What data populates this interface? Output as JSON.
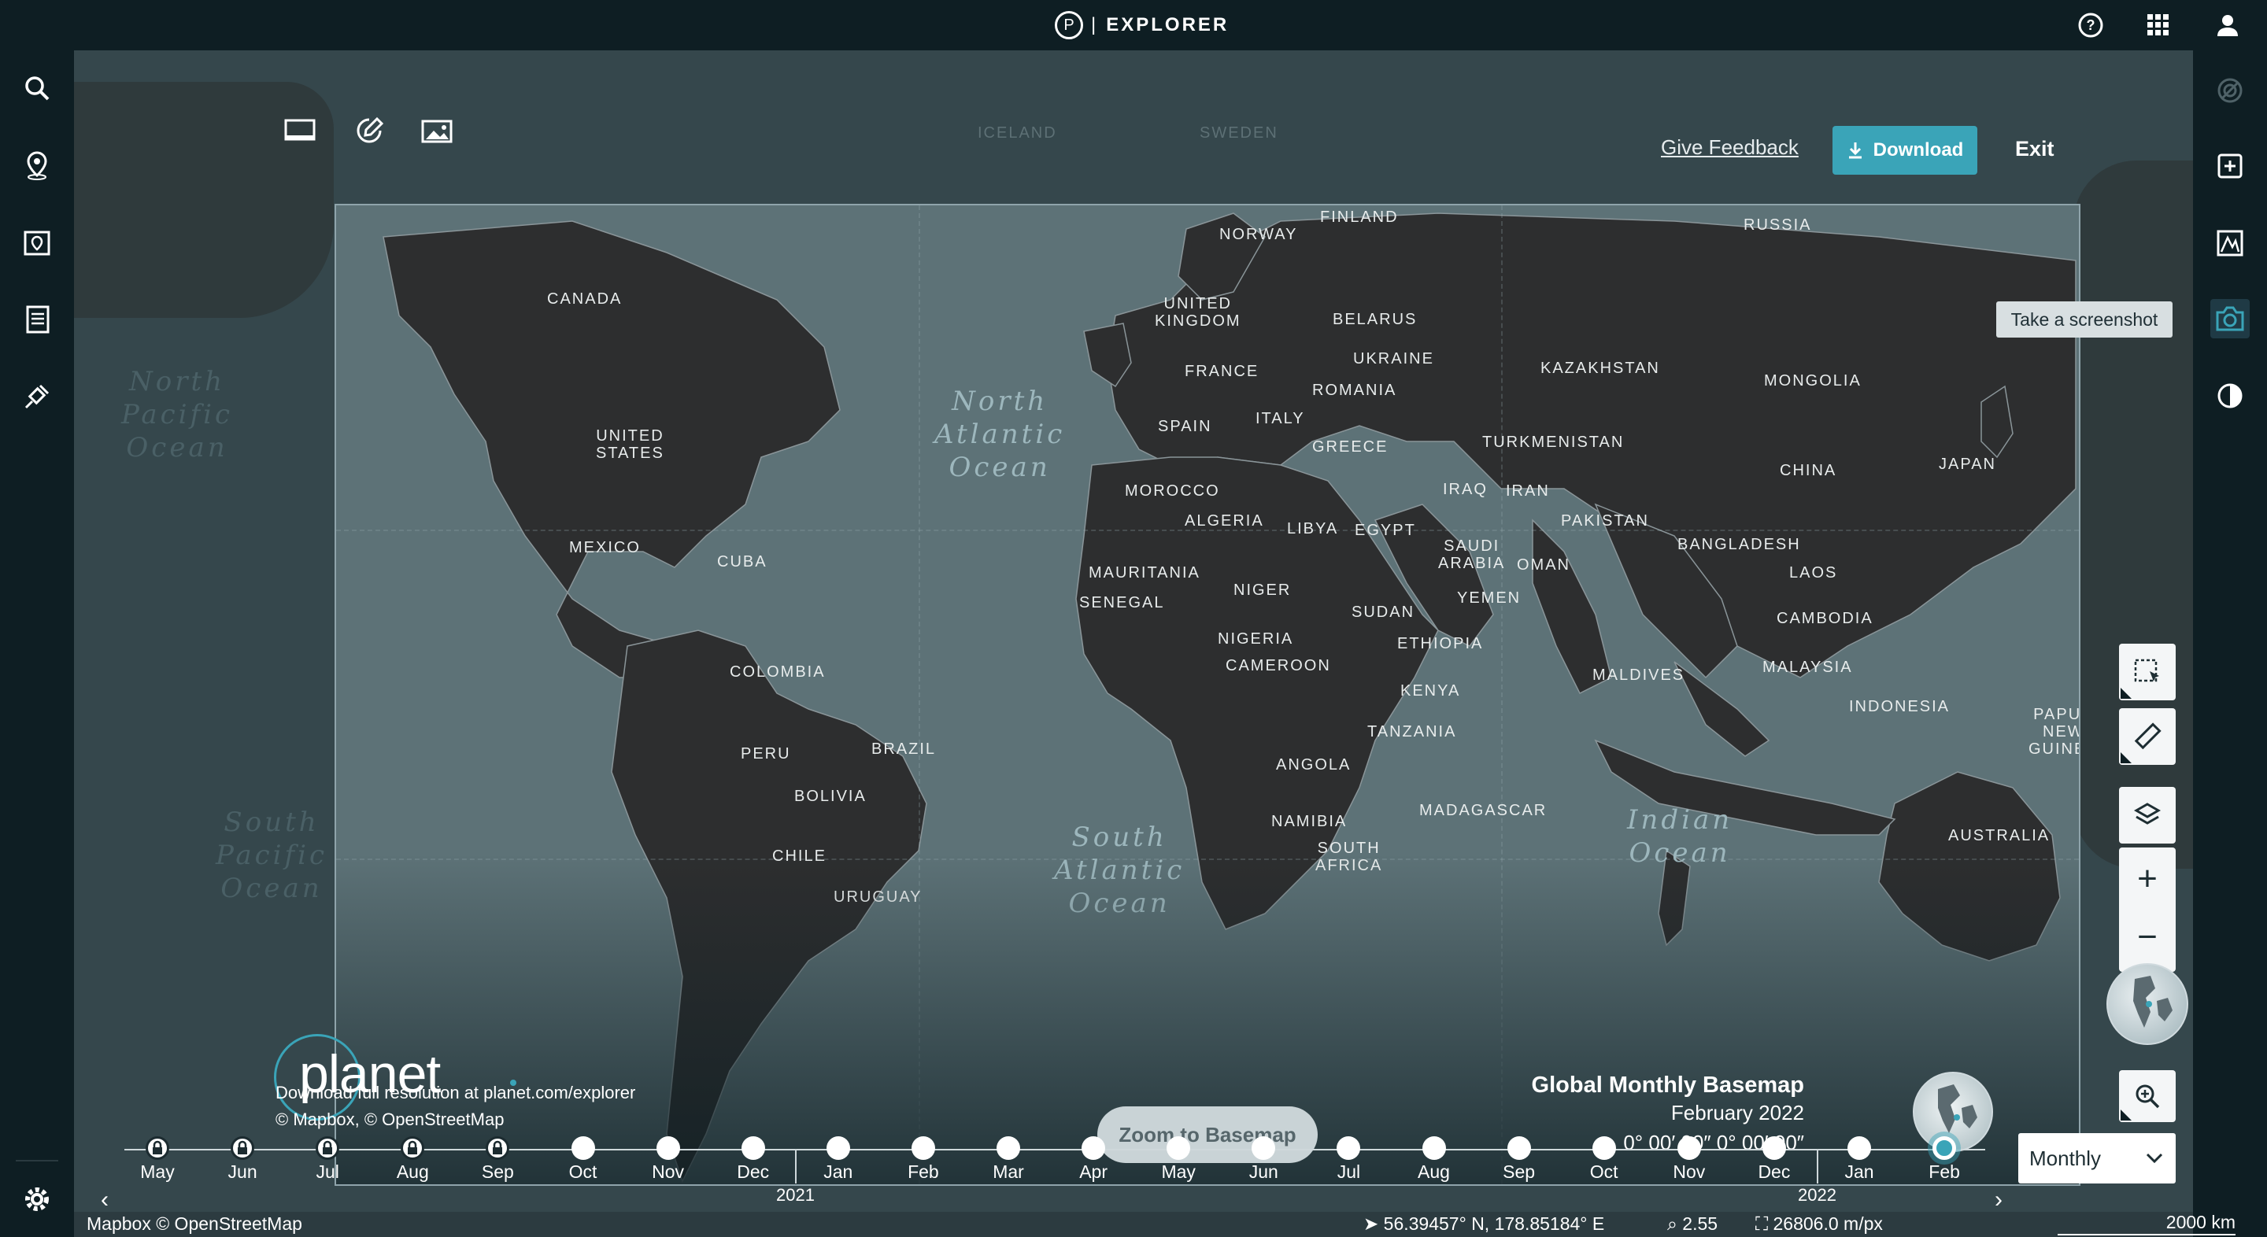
{
  "app": {
    "logo_letter": "P",
    "separator": "|",
    "title": "EXPLORER"
  },
  "top_icons": [
    "help-icon",
    "apps-grid-icon",
    "user-icon"
  ],
  "left_sidebar": [
    "search-icon",
    "location-pin-icon",
    "saved-areas-icon",
    "reports-icon",
    "tasking-satellite-icon",
    "settings-icon"
  ],
  "right_sidebar": [
    "radar-icon",
    "add-layer-icon",
    "analysis-chart-icon",
    "camera-icon",
    "compare-icon"
  ],
  "toolbar": {
    "tools": [
      "monitor-frame-icon",
      "annotate-icon",
      "image-icon"
    ],
    "feedback_label": "Give Feedback",
    "download_label": "Download",
    "exit_label": "Exit"
  },
  "tooltip": "Take a screenshot",
  "map_labels": {
    "oceans": {
      "north_atlantic": "North\nAtlantic\nOcean",
      "south_atlantic": "South\nAtlantic\nOcean",
      "indian": "Indian\nOcean",
      "north_pacific": "North\nPacific\nOcean",
      "south_pacific": "South\nPacific\nOcean"
    },
    "countries": [
      "CANADA",
      "UNITED\nSTATES",
      "MEXICO",
      "CUBA",
      "COLOMBIA",
      "PERU",
      "BRAZIL",
      "BOLIVIA",
      "CHILE",
      "URUGUAY",
      "NORWAY",
      "FINLAND",
      "RUSSIA",
      "UNITED\nKINGDOM",
      "BELARUS",
      "FRANCE",
      "UKRAINE",
      "ROMANIA",
      "SPAIN",
      "ITALY",
      "GREECE",
      "KAZAKHSTAN",
      "MONGOLIA",
      "TURKMENISTAN",
      "CHINA",
      "JAPAN",
      "MOROCCO",
      "ALGERIA",
      "LIBYA",
      "EGYPT",
      "IRAQ",
      "IRAN",
      "SAUDI\nARABIA",
      "OMAN",
      "PAKISTAN",
      "BANGLADESH",
      "LAOS",
      "MAURITANIA",
      "SENEGAL",
      "NIGER",
      "SUDAN",
      "YEMEN",
      "CAMBODIA",
      "NIGERIA",
      "ETHIOPIA",
      "CAMEROON",
      "MALDIVES",
      "MALAYSIA",
      "KENYA",
      "INDONESIA",
      "PAPUA\nNEW\nGUINEA",
      "TANZANIA",
      "ANGOLA",
      "MADAGASCAR",
      "NAMIBIA",
      "SOUTH\nAFRICA",
      "AUSTRALIA"
    ],
    "outside": [
      "ICELAND",
      "SWEDEN"
    ]
  },
  "map_controls": [
    "select-area-icon",
    "ruler-icon",
    "layers-icon",
    "zoom-in-icon",
    "zoom-out-icon",
    "globe-icon",
    "zoom-to-icon"
  ],
  "legend": {
    "brand": "planet",
    "download_note": "Download full resolution at planet.com/explorer",
    "copyright": "© Mapbox, © OpenStreetMap",
    "basemap_title": "Global Monthly Basemap",
    "basemap_date": "February 2022",
    "basemap_coords": "0° 00′ 00″ 0° 00′ 00″",
    "zoom_to_basemap": "Zoom to Basemap"
  },
  "timeline": {
    "months": [
      {
        "label": "May",
        "locked": true
      },
      {
        "label": "Jun",
        "locked": true
      },
      {
        "label": "Jul",
        "locked": true
      },
      {
        "label": "Aug",
        "locked": true
      },
      {
        "label": "Sep",
        "locked": true
      },
      {
        "label": "Oct",
        "locked": false
      },
      {
        "label": "Nov",
        "locked": false
      },
      {
        "label": "Dec",
        "locked": false
      },
      {
        "label": "Jan",
        "locked": false
      },
      {
        "label": "Feb",
        "locked": false
      },
      {
        "label": "Mar",
        "locked": false
      },
      {
        "label": "Apr",
        "locked": false
      },
      {
        "label": "May",
        "locked": false
      },
      {
        "label": "Jun",
        "locked": false
      },
      {
        "label": "Jul",
        "locked": false
      },
      {
        "label": "Aug",
        "locked": false
      },
      {
        "label": "Sep",
        "locked": false
      },
      {
        "label": "Oct",
        "locked": false
      },
      {
        "label": "Nov",
        "locked": false
      },
      {
        "label": "Dec",
        "locked": false
      },
      {
        "label": "Jan",
        "locked": false
      },
      {
        "label": "Feb",
        "locked": false,
        "selected": true
      }
    ],
    "years": [
      "2021",
      "2022"
    ],
    "interval": "Monthly"
  },
  "status": {
    "attribution": "Mapbox © OpenStreetMap",
    "coordinates": "56.39457° N, 178.85184° E",
    "zoom": "2.55",
    "resolution": "26806.0 m/px",
    "scale": "2000 km"
  },
  "colors": {
    "accent": "#3aa4b8",
    "chrome": "#0e1e23",
    "ocean": "#5d7277"
  }
}
